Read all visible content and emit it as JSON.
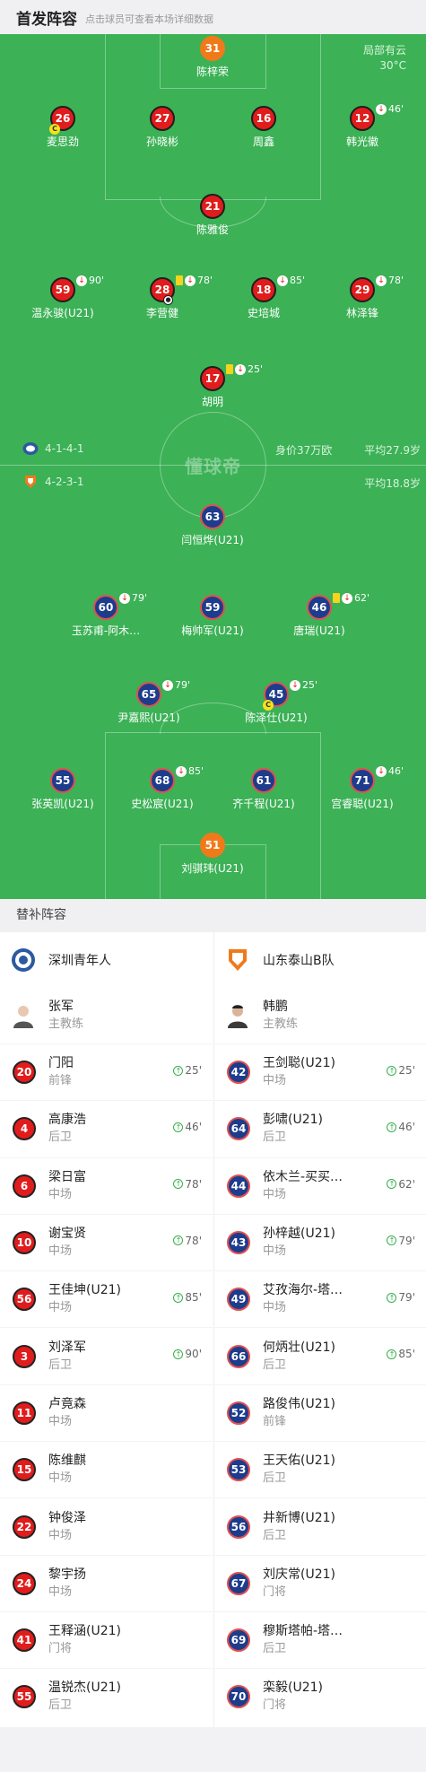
{
  "header": {
    "title": "首发阵容",
    "hint": "点击球员可查看本场详细数据"
  },
  "weather": {
    "condition": "局部有云",
    "temp": "30°C"
  },
  "watermark": "懂球帝",
  "home_team": {
    "name": "深圳青年人",
    "formation": "4-1-4-1",
    "value": "身价37万欧",
    "avg_age": "平均27.9岁"
  },
  "away_team": {
    "name": "山东泰山B队",
    "formation": "4-2-3-1",
    "avg_age": "平均18.8岁"
  },
  "starters": {
    "gk_home": {
      "num": "31",
      "name": "陈梓荣"
    },
    "d1": {
      "num": "26",
      "name": "麦思劲"
    },
    "d2": {
      "num": "27",
      "name": "孙晓彬"
    },
    "d3": {
      "num": "16",
      "name": "周鑫"
    },
    "d4": {
      "num": "12",
      "name": "韩光徽",
      "out": "46'"
    },
    "dm": {
      "num": "21",
      "name": "陈雅俊"
    },
    "m1": {
      "num": "59",
      "name": "温永骏(U21)",
      "out": "90'"
    },
    "m2": {
      "num": "28",
      "name": "李营健",
      "out": "78'"
    },
    "m3": {
      "num": "18",
      "name": "史培城",
      "out": "85'"
    },
    "m4": {
      "num": "29",
      "name": "林泽锋",
      "out": "78'"
    },
    "fw_home": {
      "num": "17",
      "name": "胡明",
      "out": "25'"
    },
    "fw_away": {
      "num": "63",
      "name": "闫恒烨(U21)"
    },
    "am1": {
      "num": "60",
      "name": "玉苏甫-阿木…",
      "out": "79'"
    },
    "am2": {
      "num": "59",
      "name": "梅帅军(U21)"
    },
    "am3": {
      "num": "46",
      "name": "唐瑞(U21)",
      "out": "62'"
    },
    "cm1": {
      "num": "65",
      "name": "尹嘉熙(U21)",
      "out": "79'"
    },
    "cm2": {
      "num": "45",
      "name": "陈泽仕(U21)",
      "out": "25'"
    },
    "b1": {
      "num": "55",
      "name": "张英凯(U21)"
    },
    "b2": {
      "num": "68",
      "name": "史松宸(U21)",
      "out": "85'"
    },
    "b3": {
      "num": "61",
      "name": "齐千程(U21)"
    },
    "b4": {
      "num": "71",
      "name": "宫睿聪(U21)",
      "out": "46'"
    },
    "gk_away": {
      "num": "51",
      "name": "刘骐玮(U21)"
    }
  },
  "subs_header": "替补阵容",
  "coach_role": "主教练",
  "home_coach": "张军",
  "away_coach": "韩鹏",
  "home_subs": [
    {
      "num": "20",
      "name": "门阳",
      "pos": "前锋",
      "in": "25'"
    },
    {
      "num": "4",
      "name": "高康浩",
      "pos": "后卫",
      "in": "46'"
    },
    {
      "num": "6",
      "name": "梁日富",
      "pos": "中场",
      "in": "78'"
    },
    {
      "num": "10",
      "name": "谢宝贤",
      "pos": "中场",
      "in": "78'"
    },
    {
      "num": "56",
      "name": "王佳坤(U21)",
      "pos": "中场",
      "in": "85'"
    },
    {
      "num": "3",
      "name": "刘泽军",
      "pos": "后卫",
      "in": "90'"
    },
    {
      "num": "11",
      "name": "卢竟森",
      "pos": "中场"
    },
    {
      "num": "15",
      "name": "陈维麒",
      "pos": "中场"
    },
    {
      "num": "22",
      "name": "钟俊泽",
      "pos": "中场"
    },
    {
      "num": "24",
      "name": "黎宇扬",
      "pos": "中场"
    },
    {
      "num": "41",
      "name": "王释涵(U21)",
      "pos": "门将"
    },
    {
      "num": "55",
      "name": "温锐杰(U21)",
      "pos": "后卫"
    }
  ],
  "away_subs": [
    {
      "num": "42",
      "name": "王剑聪(U21)",
      "pos": "中场",
      "in": "25'"
    },
    {
      "num": "64",
      "name": "彭啸(U21)",
      "pos": "后卫",
      "in": "46'"
    },
    {
      "num": "44",
      "name": "依木兰-买买…",
      "pos": "中场",
      "in": "62'"
    },
    {
      "num": "43",
      "name": "孙梓越(U21)",
      "pos": "中场",
      "in": "79'"
    },
    {
      "num": "49",
      "name": "艾孜海尔-塔…",
      "pos": "中场",
      "in": "79'"
    },
    {
      "num": "66",
      "name": "何炳壮(U21)",
      "pos": "后卫",
      "in": "85'"
    },
    {
      "num": "52",
      "name": "路俊伟(U21)",
      "pos": "前锋"
    },
    {
      "num": "53",
      "name": "王天佑(U21)",
      "pos": "后卫"
    },
    {
      "num": "56",
      "name": "井新博(U21)",
      "pos": "后卫"
    },
    {
      "num": "67",
      "name": "刘庆常(U21)",
      "pos": "门将"
    },
    {
      "num": "69",
      "name": "穆斯塔帕-塔…",
      "pos": "后卫"
    },
    {
      "num": "70",
      "name": "栾毅(U21)",
      "pos": "门将"
    }
  ]
}
